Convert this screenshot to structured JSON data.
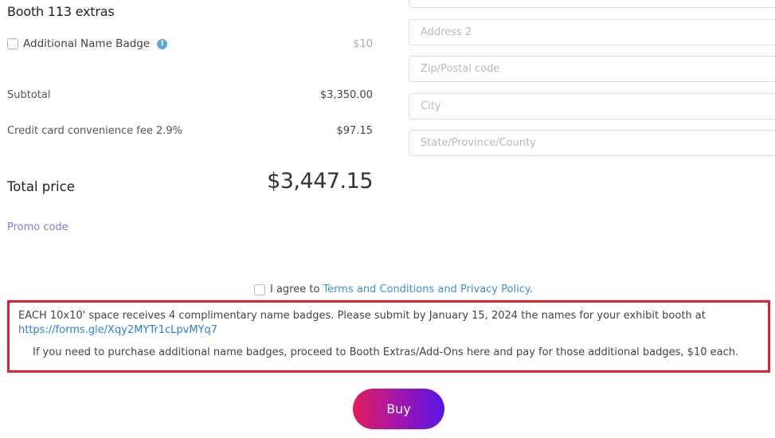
{
  "extras": {
    "title": "Booth 113 extras",
    "items": [
      {
        "label": "Additional Name Badge",
        "price": "$10",
        "checked": false,
        "info_icon": "info-icon"
      }
    ]
  },
  "summary": {
    "subtotal_label": "Subtotal",
    "subtotal_value": "$3,350.00",
    "fee_label": "Credit card convenience fee 2.9%",
    "fee_value": "$97.15",
    "total_label": "Total price",
    "total_value": "$3,447.15"
  },
  "promo_label": "Promo code",
  "address": {
    "fields": [
      {
        "placeholder": "",
        "value": ""
      },
      {
        "placeholder": "Address 2",
        "value": ""
      },
      {
        "placeholder": "Zip/Postal code",
        "value": ""
      },
      {
        "placeholder": "City",
        "value": ""
      },
      {
        "placeholder": "State/Province/County",
        "value": ""
      }
    ]
  },
  "agree": {
    "prefix": "I agree to",
    "link": "Terms and Conditions and Privacy Policy.",
    "checked": false
  },
  "notice": {
    "line1": "EACH 10x10' space receives 4 complimentary name badges.  Please submit by January 15, 2024 the names for your exhibit booth at",
    "url": "https://forms.gle/Xqy2MYTr1cLpvMYq7",
    "line2": "If you need to purchase additional name badges, proceed to Booth Extras/Add-Ons here and pay for those additional badges, $10 each."
  },
  "buy_label": "Buy",
  "colors": {
    "accent_link": "#3d8fe0",
    "promo": "#8a73e8",
    "notice_border": "#e3202f",
    "buy_gradient_start": "#e41b5b",
    "buy_gradient_end": "#5716e3"
  }
}
